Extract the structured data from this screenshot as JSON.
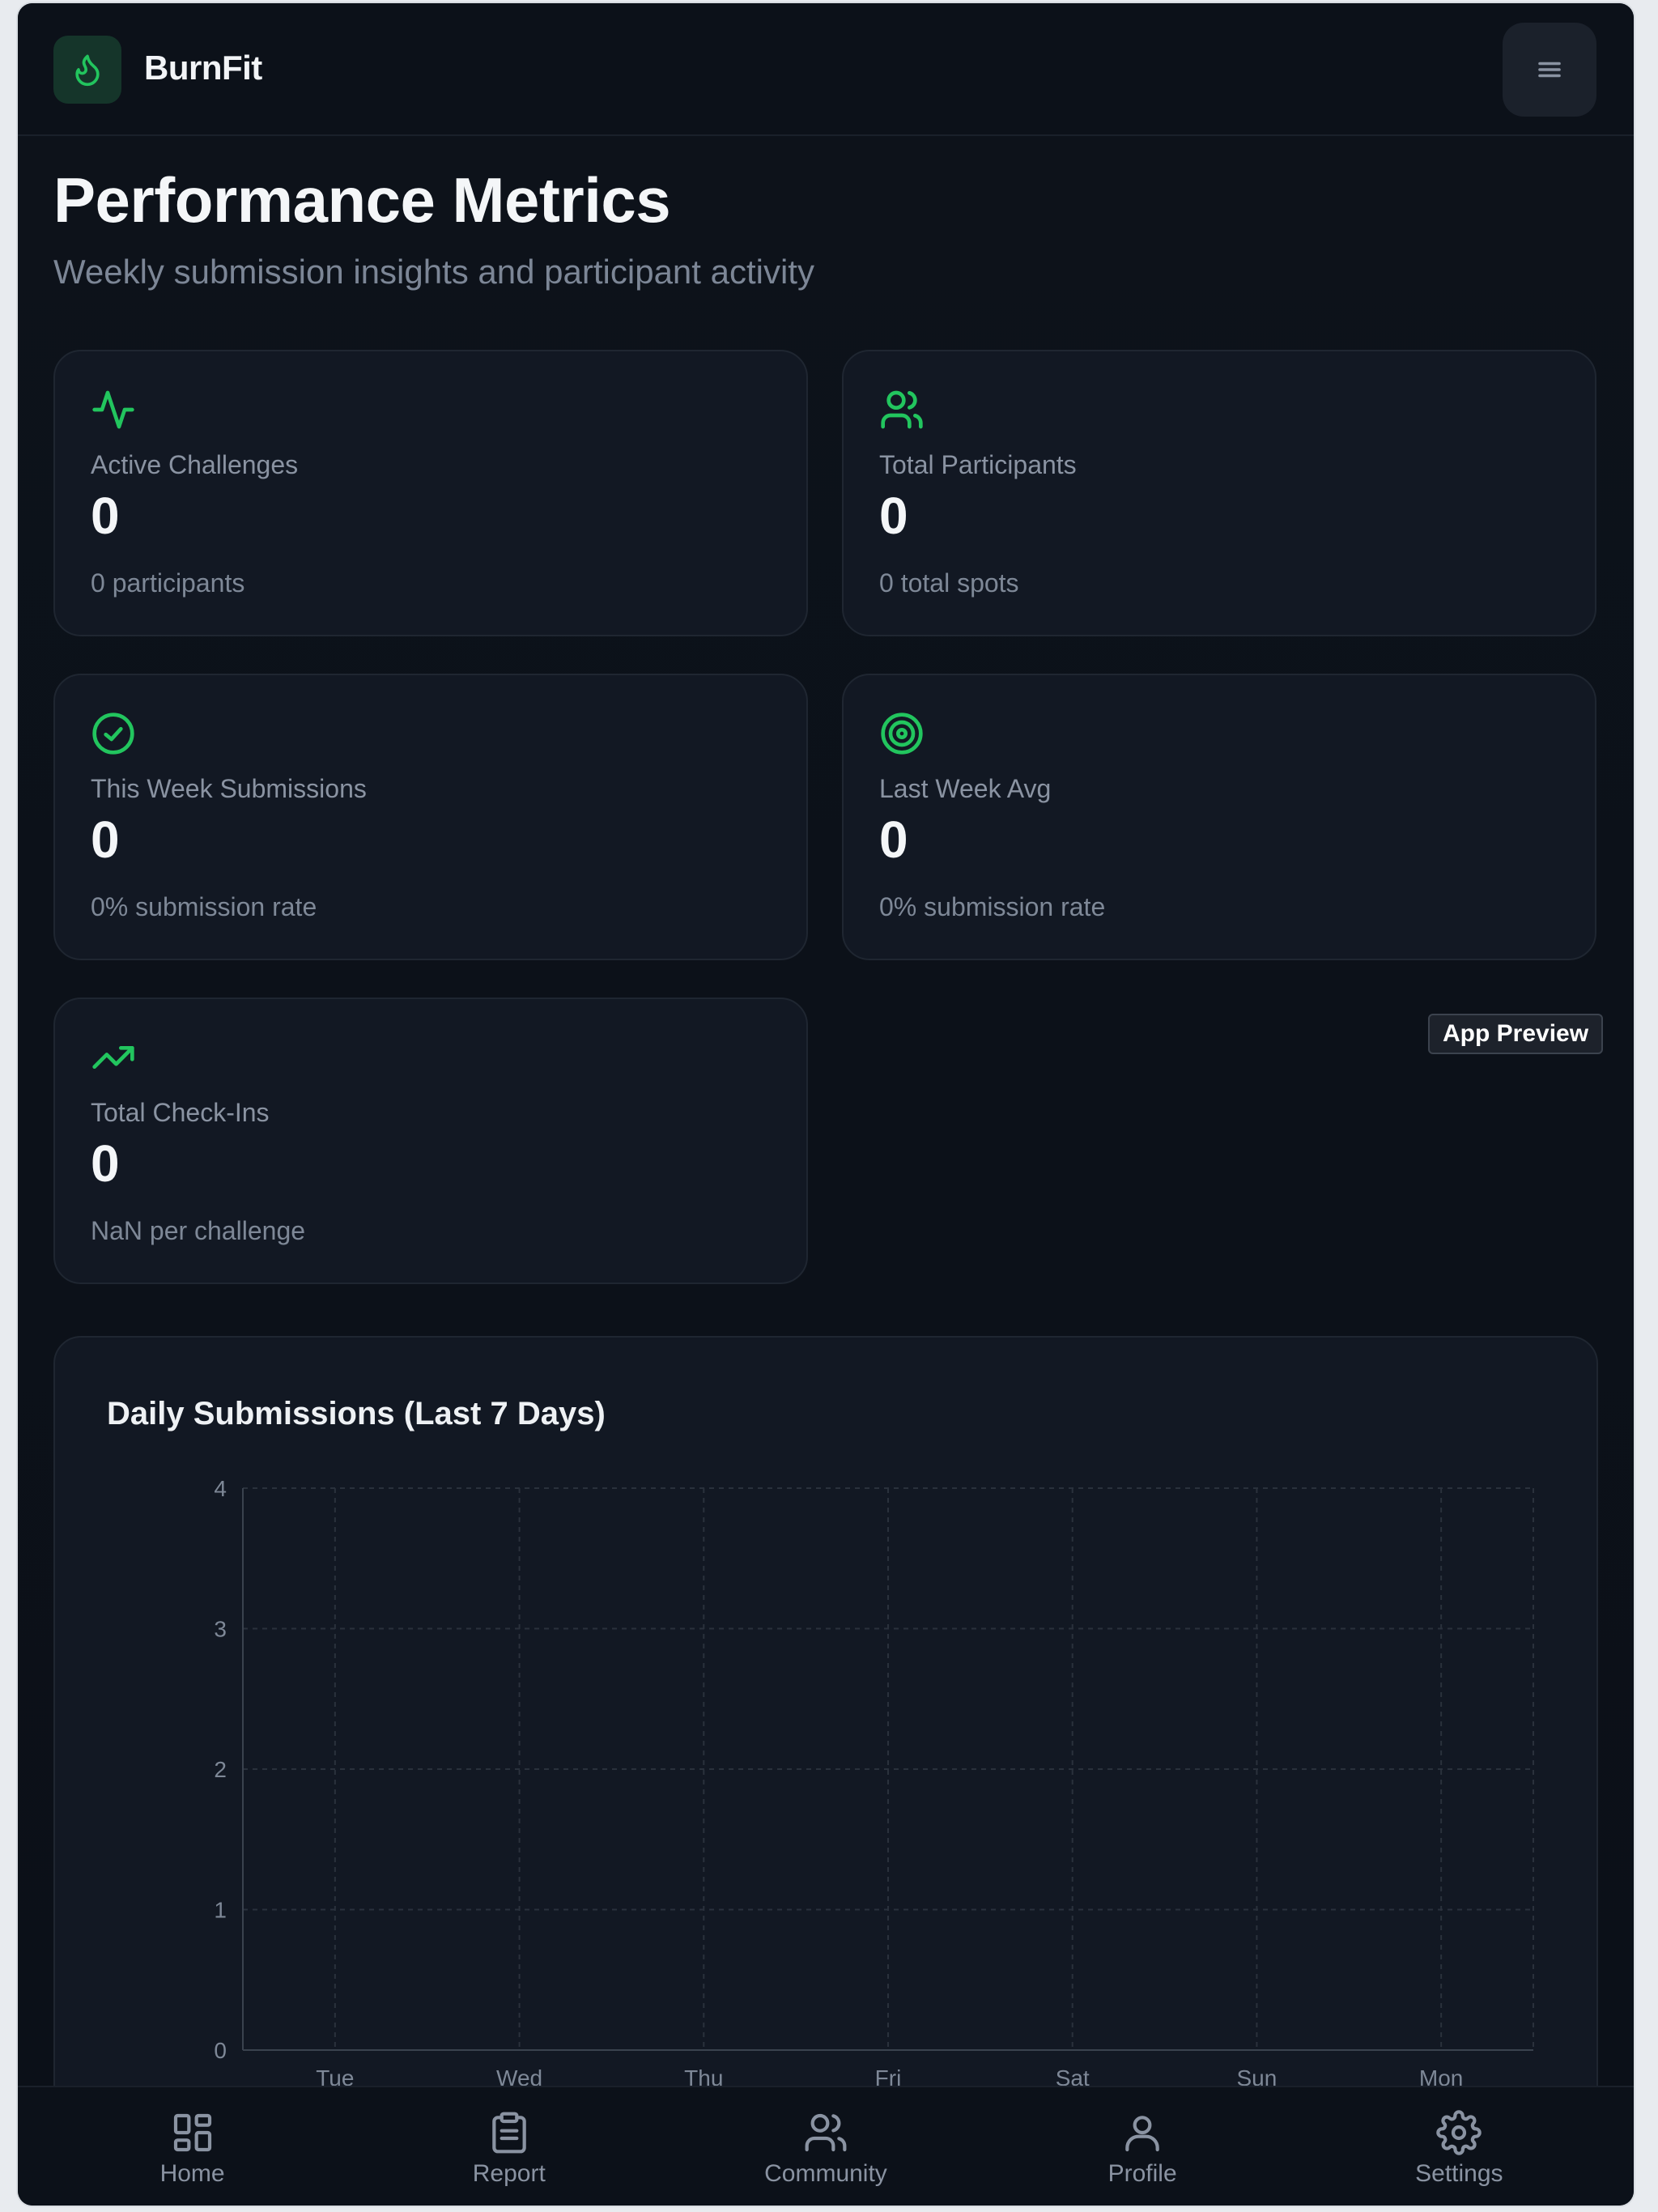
{
  "header": {
    "brand": "BurnFit",
    "logo_icon": "flame-icon",
    "menu_icon": "menu-icon"
  },
  "page": {
    "title": "Performance Metrics",
    "subtitle": "Weekly submission insights and participant activity"
  },
  "colors": {
    "accent": "#22c55e",
    "background": "#0d121a",
    "card": "#121823"
  },
  "stats": [
    {
      "icon": "activity-icon",
      "label": "Active Challenges",
      "value": "0",
      "sub": "0 participants"
    },
    {
      "icon": "users-icon",
      "label": "Total Participants",
      "value": "0",
      "sub": "0 total spots"
    },
    {
      "icon": "check-circle-icon",
      "label": "This Week Submissions",
      "value": "0",
      "sub": "0% submission rate"
    },
    {
      "icon": "target-icon",
      "label": "Last Week Avg",
      "value": "0",
      "sub": "0% submission rate"
    },
    {
      "icon": "trending-up-icon",
      "label": "Total Check-Ins",
      "value": "0",
      "sub": "NaN per challenge"
    }
  ],
  "badge": "App Preview",
  "chart_data": {
    "type": "bar",
    "title": "Daily Submissions (Last 7 Days)",
    "categories": [
      "Tue",
      "Wed",
      "Thu",
      "Fri",
      "Sat",
      "Sun",
      "Mon"
    ],
    "values": [
      0,
      0,
      0,
      0,
      0,
      0,
      0
    ],
    "ylim": [
      0,
      4
    ],
    "yticks": [
      "0",
      "1",
      "2",
      "3",
      "4"
    ],
    "grid": true,
    "xlabel": "",
    "ylabel": ""
  },
  "nav": [
    {
      "icon": "home-grid-icon",
      "label": "Home"
    },
    {
      "icon": "clipboard-icon",
      "label": "Report"
    },
    {
      "icon": "users-icon",
      "label": "Community"
    },
    {
      "icon": "user-icon",
      "label": "Profile"
    },
    {
      "icon": "gear-icon",
      "label": "Settings"
    }
  ]
}
